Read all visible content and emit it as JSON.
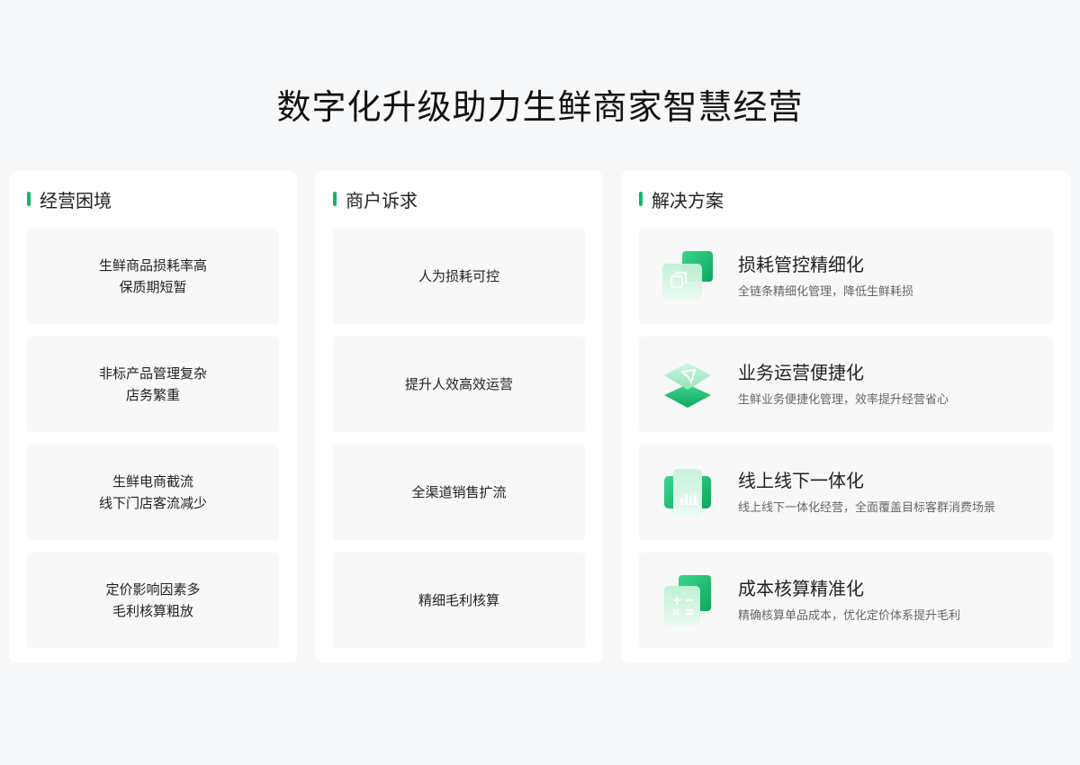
{
  "page": {
    "title": "数字化升级助力生鲜商家智慧经营"
  },
  "colors": {
    "accent": "#12b76a",
    "card_bg": "#f8f8f8",
    "page_bg": "#f7f8fa"
  },
  "columns": [
    {
      "title": "经营困境",
      "items": [
        {
          "line1": "生鲜商品损耗率高",
          "line2": "保质期短暂"
        },
        {
          "line1": "非标产品管理复杂",
          "line2": "店务繁重"
        },
        {
          "line1": "生鲜电商截流",
          "line2": "线下门店客流减少"
        },
        {
          "line1": "定价影响因素多",
          "line2": "毛利核算粗放"
        }
      ]
    },
    {
      "title": "商户诉求",
      "items": [
        {
          "text": "人为损耗可控"
        },
        {
          "text": "提升人效高效运营"
        },
        {
          "text": "全渠道销售扩流"
        },
        {
          "text": "精细毛利核算"
        }
      ]
    },
    {
      "title": "解决方案",
      "items": [
        {
          "icon": "stacked-squares-icon",
          "title": "损耗管控精细化",
          "desc": "全链条精细化管理，降低生鲜耗损"
        },
        {
          "icon": "send-layers-icon",
          "title": "业务运营便捷化",
          "desc": "生鲜业务便捷化管理，效率提升经营省心"
        },
        {
          "icon": "phone-chart-icon",
          "title": "线上线下一体化",
          "desc": "线上线下一体化经营，全面覆盖目标客群消费场景"
        },
        {
          "icon": "calculator-icon",
          "title": "成本核算精准化",
          "desc": "精确核算单品成本，优化定价体系提升毛利"
        }
      ]
    }
  ]
}
